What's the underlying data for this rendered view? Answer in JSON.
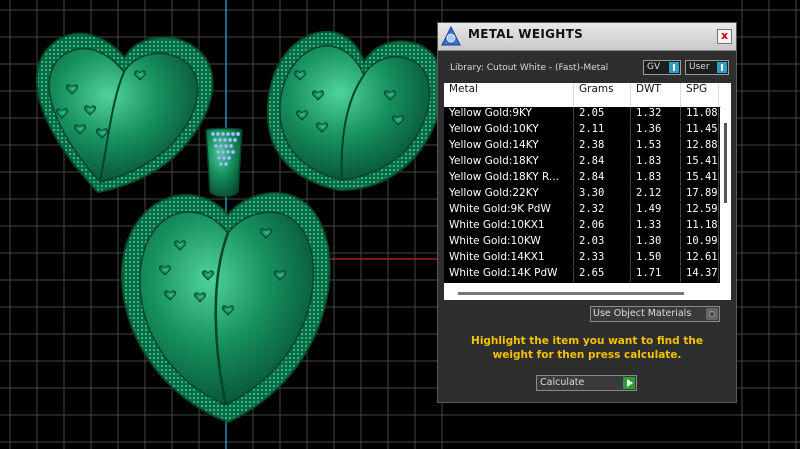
{
  "panel": {
    "title": "METAL WEIGHTS",
    "close_label": "x",
    "library": "Library: Cutout White - (Fast)-Metal",
    "gv_label": "GV",
    "user_label": "User",
    "columns": [
      "Metal",
      "Grams",
      "DWT",
      "SPG"
    ],
    "rows": [
      [
        "Yellow Gold:9KY",
        "2.05",
        "1.32",
        "11.08"
      ],
      [
        "Yellow Gold:10KY",
        "2.11",
        "1.36",
        "11.45"
      ],
      [
        "Yellow Gold:14KY",
        "2.38",
        "1.53",
        "12.88"
      ],
      [
        "Yellow Gold:18KY",
        "2.84",
        "1.83",
        "15.41"
      ],
      [
        "Yellow Gold:18KY R...",
        "2.84",
        "1.83",
        "15.41"
      ],
      [
        "Yellow Gold:22KY",
        "3.30",
        "2.12",
        "17.89"
      ],
      [
        "White Gold:9K PdW",
        "2.32",
        "1.49",
        "12.59"
      ],
      [
        "White Gold:10KX1",
        "2.06",
        "1.33",
        "11.18"
      ],
      [
        "White Gold:10KW",
        "2.03",
        "1.30",
        "10.99"
      ],
      [
        "White Gold:14KX1",
        "2.33",
        "1.50",
        "12.61"
      ],
      [
        "White Gold:14K PdW",
        "2.65",
        "1.71",
        "14.37"
      ]
    ],
    "use_object_materials": "Use Object Materials",
    "instruction": "Highlight the item you want to find the weight for then press calculate.",
    "calculate_label": "Calculate"
  },
  "colors": {
    "model_green": "#128a5c",
    "highlight_yellow": "#f3c200",
    "grid": "#4a4a4a",
    "diamonds": "#9ec8f0"
  }
}
